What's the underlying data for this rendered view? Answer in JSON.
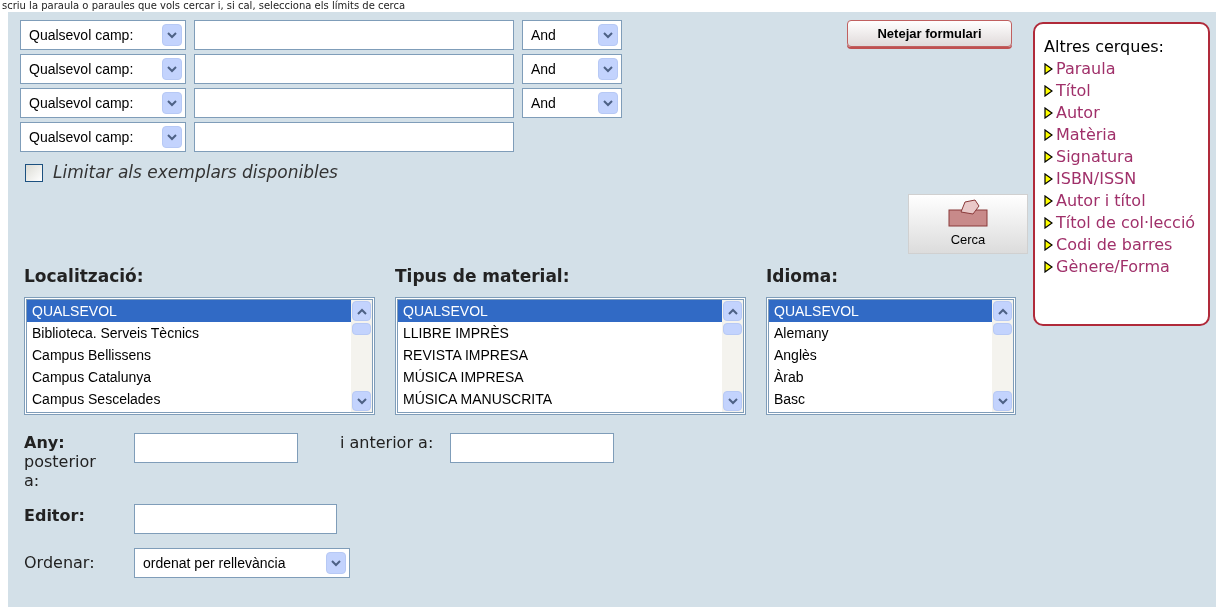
{
  "intro": "scriu la paraula o paraules que vols cercar i, si cal, selecciona els límits de cerca",
  "search_rows": [
    {
      "field": "Qualsevol camp:",
      "operator": "And"
    },
    {
      "field": "Qualsevol camp:",
      "operator": "And"
    },
    {
      "field": "Qualsevol camp:",
      "operator": "And"
    },
    {
      "field": "Qualsevol camp:"
    }
  ],
  "clear_button": "Netejar formulari",
  "limit_checkbox": {
    "label": "Limitar als exemplars disponibles",
    "checked": false
  },
  "search_button": "Cerca",
  "other_searches": {
    "title": "Altres cerques:",
    "links": [
      "Paraula",
      "Títol",
      "Autor",
      "Matèria",
      "Signatura",
      "ISBN/ISSN",
      "Autor i títol",
      "Títol de col·lecció",
      "Codi de barres",
      "Gènere/Forma"
    ]
  },
  "lists": [
    {
      "label": "Localització:",
      "options": [
        {
          "text": "QUALSEVOL",
          "selected": true
        },
        {
          "text": "Biblioteca. Serveis Tècnics",
          "selected": false
        },
        {
          "text": "Campus Bellissens",
          "selected": false
        },
        {
          "text": "Campus Catalunya",
          "selected": false
        },
        {
          "text": "Campus Sescelades",
          "selected": false
        }
      ]
    },
    {
      "label": "Tipus de material:",
      "options": [
        {
          "text": "QUALSEVOL",
          "selected": true
        },
        {
          "text": "LLIBRE IMPRÈS",
          "selected": false
        },
        {
          "text": "REVISTA IMPRESA",
          "selected": false
        },
        {
          "text": "MÚSICA IMPRESA",
          "selected": false
        },
        {
          "text": "MÚSICA MANUSCRITA",
          "selected": false
        }
      ]
    },
    {
      "label": "Idioma:",
      "options": [
        {
          "text": "QUALSEVOL",
          "selected": true
        },
        {
          "text": "Alemany",
          "selected": false
        },
        {
          "text": "Anglès",
          "selected": false
        },
        {
          "text": "Àrab",
          "selected": false
        },
        {
          "text": "Basc",
          "selected": false
        }
      ]
    }
  ],
  "year": {
    "label": "Any:",
    "from_label": "posterior a:",
    "to_label": "i anterior a:"
  },
  "editor": {
    "label": "Editor:"
  },
  "sort": {
    "label": "Ordenar:",
    "value": "ordenat per rellevància"
  }
}
